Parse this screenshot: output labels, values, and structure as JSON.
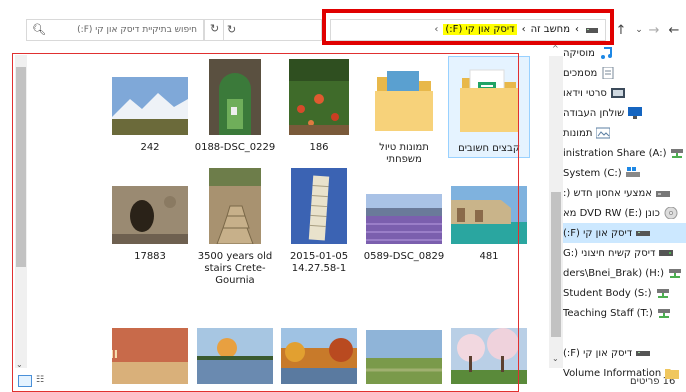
{
  "nav": {
    "back": "←",
    "forward": "→",
    "up": "↑",
    "recent": "⌄",
    "refresh": "↻",
    "dropdown": "⌄"
  },
  "address": {
    "root": "מחשב זה",
    "current": "דיסק און קי (F:)",
    "sep": "›"
  },
  "search": {
    "placeholder": "חיפוש בתיקיית דיסק און קי (F:)"
  },
  "items": [
    {
      "label": "קבצים חשובים",
      "kind": "folder",
      "art": "folder-sheets"
    },
    {
      "label": "תמונות טיול משפחתי",
      "kind": "folder",
      "art": "folder-photos"
    },
    {
      "label": "186",
      "kind": "image",
      "art": "flowers"
    },
    {
      "label": "0188-DSC_0229",
      "kind": "image",
      "art": "window"
    },
    {
      "label": "242",
      "kind": "image",
      "art": "mountains"
    },
    {
      "label": "481",
      "kind": "image",
      "art": "cliffs"
    },
    {
      "label": "0589-DSC_0829",
      "kind": "image",
      "art": "lavender"
    },
    {
      "label": "2015-01-05 14.27.58-1",
      "kind": "image",
      "art": "pisa"
    },
    {
      "label": "3500 years old stairs Crete-Gournia",
      "kind": "image",
      "art": "stairs"
    },
    {
      "label": "17883",
      "kind": "image",
      "art": "cave"
    },
    {
      "label": "",
      "kind": "image",
      "art": "blossom"
    },
    {
      "label": "",
      "kind": "image",
      "art": "field"
    },
    {
      "label": "",
      "kind": "image",
      "art": "autumn"
    },
    {
      "label": "",
      "kind": "image",
      "art": "lake"
    },
    {
      "label": "",
      "kind": "image",
      "art": "sign"
    }
  ],
  "navpane": [
    {
      "label": "מוסיקה",
      "icon": "music-icon",
      "color": "#1e88e5"
    },
    {
      "label": "מסמכים",
      "icon": "documents-icon",
      "color": "#7a8a99"
    },
    {
      "label": "סרטי וידאו",
      "icon": "videos-icon",
      "color": "#3b4a5a"
    },
    {
      "label": "שולחן העבודה",
      "icon": "desktop-icon",
      "color": "#1565c0"
    },
    {
      "label": "תמונות",
      "icon": "pictures-icon",
      "color": "#5b7fa3"
    },
    {
      "label": "inistration Share (A:)",
      "icon": "network-drive-icon",
      "color": "#4caf50"
    },
    {
      "label": "System (C:)",
      "icon": "windows-drive-icon",
      "color": "#1e88e5"
    },
    {
      "label": "אמצעי אחסון חדש (:",
      "icon": "drive-icon",
      "color": "#777"
    },
    {
      "label": "כונן DVD RW (E:) מא",
      "icon": "dvd-icon",
      "color": "#999"
    },
    {
      "label": "דיסק און קי (F:)",
      "icon": "usb-drive-icon",
      "color": "#555"
    },
    {
      "label": "דיסק קשיח חיצוני (:G",
      "icon": "external-drive-icon",
      "color": "#555"
    },
    {
      "label": "ders\\Bnei_Brak) (H:)",
      "icon": "network-drive-icon",
      "color": "#4caf50"
    },
    {
      "label": "Student Body (S:)",
      "icon": "network-drive-icon",
      "color": "#4caf50"
    },
    {
      "label": "Teaching Staff (T:)",
      "icon": "network-drive-icon",
      "color": "#4caf50"
    },
    {
      "label": "",
      "icon": "spacer",
      "color": "#fff"
    },
    {
      "label": "דיסק און קי (F:)",
      "icon": "usb-drive-icon",
      "color": "#555"
    },
    {
      "label": "Volume Information",
      "icon": "folder-icon",
      "color": "#f0c75e"
    }
  ],
  "status": {
    "count": "16 פריטים"
  },
  "colors": {
    "highlight": "#ffff00",
    "red_frame": "#e00000",
    "selection": "#cce8ff"
  }
}
